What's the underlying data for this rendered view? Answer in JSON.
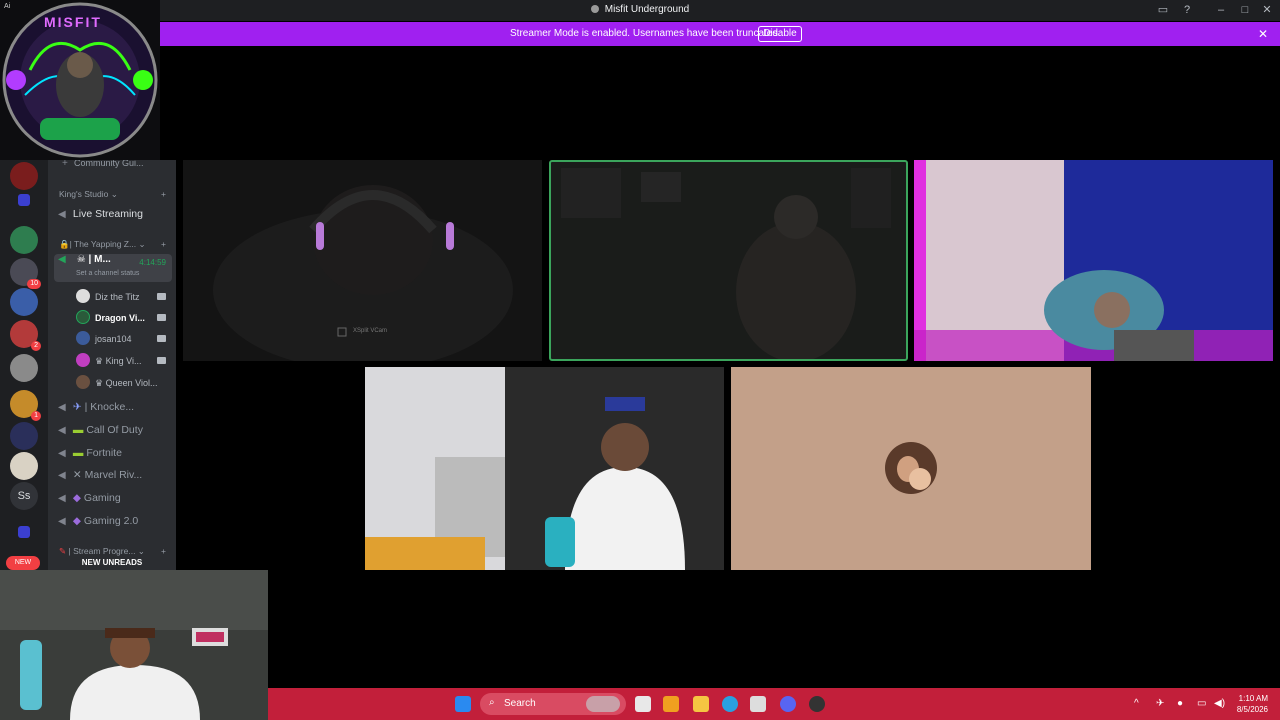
{
  "window": {
    "title": "Misfit Underground",
    "controls": [
      "minimize-icon",
      "maximize-icon",
      "close-icon"
    ]
  },
  "logo": {
    "corner_label": "Ai",
    "text": "MISFIT"
  },
  "banner": {
    "message": "Streamer Mode is enabled. Usernames have been truncated.",
    "button": "Disable",
    "bg": "#a020f0"
  },
  "sidebar": {
    "top_item": "Community Gui...",
    "categories": [
      {
        "label": "King's Studio"
      },
      {
        "label": "| The Yapping Z..."
      },
      {
        "label": "| Stream Progre..."
      }
    ],
    "channels": [
      {
        "label": "Live Streaming",
        "icon": "speaker-icon"
      },
      {
        "label": "| M...",
        "icon": "skull-icon",
        "timer": "4:14:59",
        "status": "Set a channel status",
        "active": true
      },
      {
        "label": "| Knocke...",
        "icon": "speaker-icon"
      },
      {
        "label": "Call Of Duty",
        "icon": "speaker-icon"
      },
      {
        "label": "Fortnite",
        "icon": "speaker-icon"
      },
      {
        "label": "Marvel Riv...",
        "icon": "speaker-icon"
      },
      {
        "label": "Gaming",
        "icon": "speaker-icon"
      },
      {
        "label": "Gaming 2.0",
        "icon": "speaker-icon"
      }
    ],
    "voice_users": [
      {
        "name": "Diz the Titz",
        "bold": false
      },
      {
        "name": "Dragon Vi...",
        "bold": true
      },
      {
        "name": "josan104",
        "bold": false
      },
      {
        "name": "King Vi...",
        "bold": false
      },
      {
        "name": "Queen Viol...",
        "bold": false
      }
    ],
    "new_pill": "NEW",
    "new_unreads": "NEW UNREADS"
  },
  "rail": {
    "badges": [
      "10",
      "2",
      "1"
    ],
    "initials": "Ss"
  },
  "tiles": [
    {
      "name": "tile-1",
      "watermark": "XSplit VCam"
    },
    {
      "name": "tile-2",
      "speaking": true
    },
    {
      "name": "tile-3"
    },
    {
      "name": "tile-4"
    },
    {
      "name": "tile-5"
    }
  ],
  "taskbar": {
    "search": "Search",
    "time": "1:10 AM",
    "date": "8/5/2026",
    "bg": "#c21f3a"
  }
}
